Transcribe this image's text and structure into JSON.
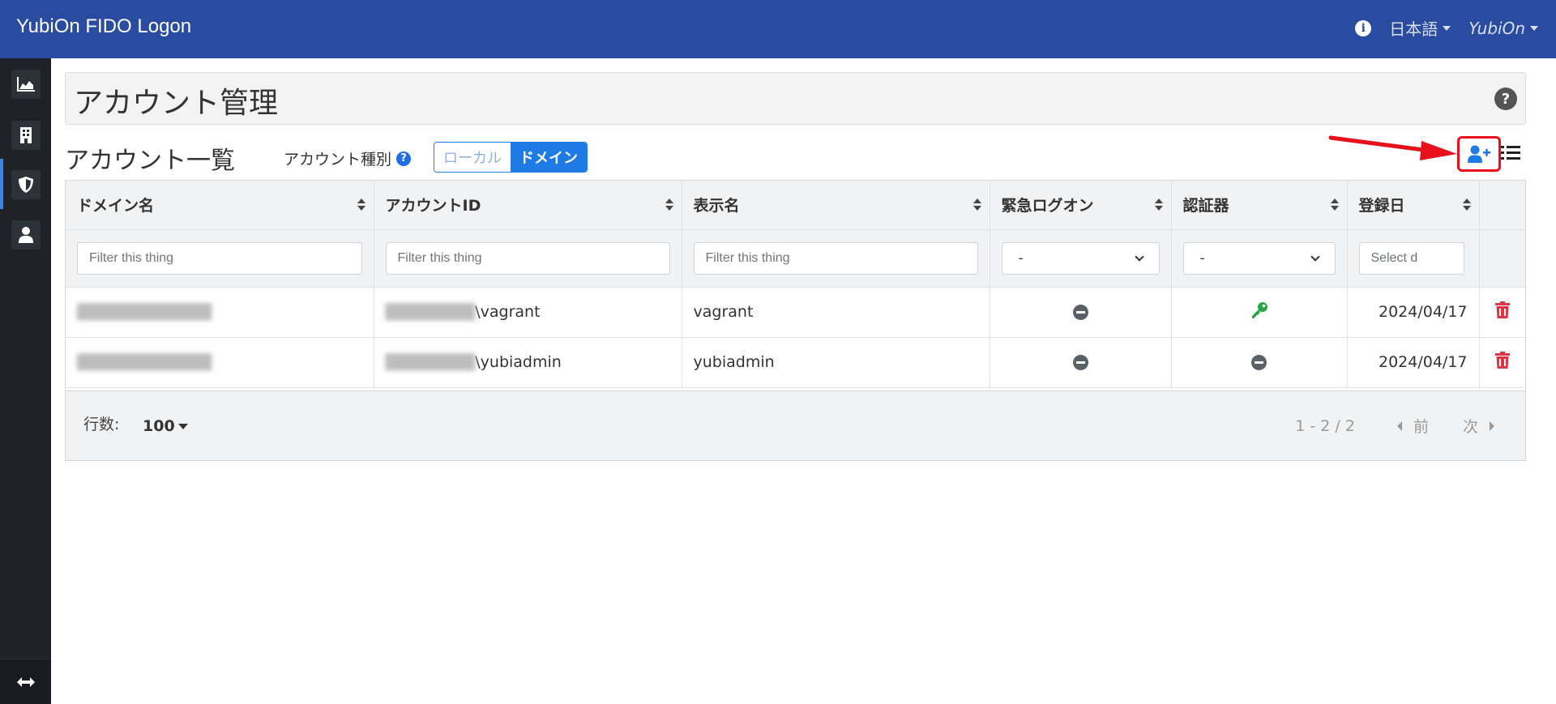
{
  "app": {
    "brand": "YubiOn FIDO Logon",
    "language": "日本語",
    "user": "YubiOn"
  },
  "sidebar": {
    "items": [
      {
        "icon": "chart-area-icon"
      },
      {
        "icon": "building-icon"
      },
      {
        "icon": "shield-icon",
        "active": true
      },
      {
        "icon": "user-icon"
      }
    ],
    "bottom_icon": "expand-arrows-icon"
  },
  "page": {
    "title": "アカウント管理"
  },
  "section": {
    "title": "アカウント一覧",
    "type_label": "アカウント種別",
    "toggle": {
      "local": "ローカル",
      "domain": "ドメイン",
      "selected": "domain"
    }
  },
  "table": {
    "columns": [
      "ドメイン名",
      "アカウントID",
      "表示名",
      "緊急ログオン",
      "認証器",
      "登録日"
    ],
    "filters": {
      "domain_placeholder": "Filter this thing",
      "account_placeholder": "Filter this thing",
      "display_placeholder": "Filter this thing",
      "emergency_value": "-",
      "authenticator_value": "-",
      "date_placeholder": "Select d"
    },
    "rows": [
      {
        "account_suffix": "\\vagrant",
        "display_name": "vagrant",
        "emergency": "none",
        "authenticator": "key",
        "date": "2024/04/17"
      },
      {
        "account_suffix": "\\yubiadmin",
        "display_name": "yubiadmin",
        "emergency": "none",
        "authenticator": "none",
        "date": "2024/04/17"
      }
    ]
  },
  "footer": {
    "rows_label": "行数:",
    "rows_value": "100",
    "range": "1 - 2 / 2",
    "prev": "前",
    "next": "次"
  },
  "colors": {
    "topbar": "#2a4ca0",
    "primary": "#1e7be6",
    "danger": "#dc3545",
    "success": "#28a745",
    "highlight": "#e8101b"
  }
}
